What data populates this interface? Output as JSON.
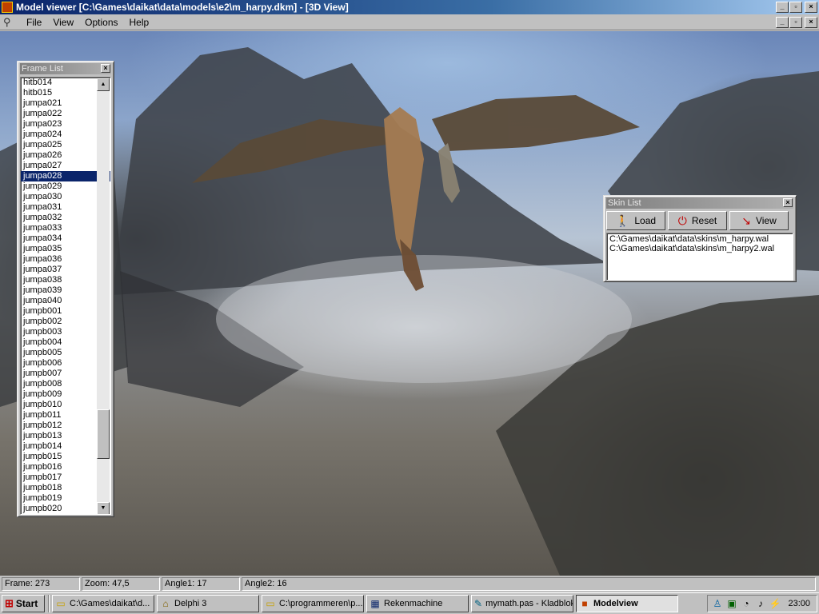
{
  "window": {
    "title": "Model viewer [C:\\Games\\daikat\\data\\models\\e2\\m_harpy.dkm] - [3D View]",
    "minimize": "_",
    "restore": "▫",
    "close": "×"
  },
  "menu": {
    "items": [
      "File",
      "View",
      "Options",
      "Help"
    ]
  },
  "frame_list": {
    "title": "Frame List",
    "close": "×",
    "selected": "jumpa028",
    "items": [
      "hitb014",
      "hitb015",
      "jumpa021",
      "jumpa022",
      "jumpa023",
      "jumpa024",
      "jumpa025",
      "jumpa026",
      "jumpa027",
      "jumpa028",
      "jumpa029",
      "jumpa030",
      "jumpa031",
      "jumpa032",
      "jumpa033",
      "jumpa034",
      "jumpa035",
      "jumpa036",
      "jumpa037",
      "jumpa038",
      "jumpa039",
      "jumpa040",
      "jumpb001",
      "jumpb002",
      "jumpb003",
      "jumpb004",
      "jumpb005",
      "jumpb006",
      "jumpb007",
      "jumpb008",
      "jumpb009",
      "jumpb010",
      "jumpb011",
      "jumpb012",
      "jumpb013",
      "jumpb014",
      "jumpb015",
      "jumpb016",
      "jumpb017",
      "jumpb018",
      "jumpb019",
      "jumpb020"
    ],
    "scroll_up": "▲",
    "scroll_down": "▼"
  },
  "skin_list": {
    "title": "Skin List",
    "close": "×",
    "load_label": "Load",
    "reset_label": "Reset",
    "view_label": "View",
    "items": [
      "C:\\Games\\daikat\\data\\skins\\m_harpy.wal",
      "C:\\Games\\daikat\\data\\skins\\m_harpy2.wal"
    ]
  },
  "status": {
    "frame": "Frame: 273",
    "zoom": "Zoom: 47,5",
    "angle1": "Angle1: 17",
    "angle2": "Angle2: 16"
  },
  "taskbar": {
    "start_label": "Start",
    "tasks": [
      {
        "label": "C:\\Games\\daikat\\d...",
        "icon": "folder-icon"
      },
      {
        "label": "Delphi 3",
        "icon": "delphi-icon"
      },
      {
        "label": "C:\\programmeren\\p...",
        "icon": "folder-icon"
      },
      {
        "label": "Rekenmachine",
        "icon": "calculator-icon"
      },
      {
        "label": "mymath.pas - Kladblok",
        "icon": "notepad-icon"
      },
      {
        "label": "Modelview",
        "icon": "modelview-icon"
      }
    ],
    "clock": "23:00"
  }
}
